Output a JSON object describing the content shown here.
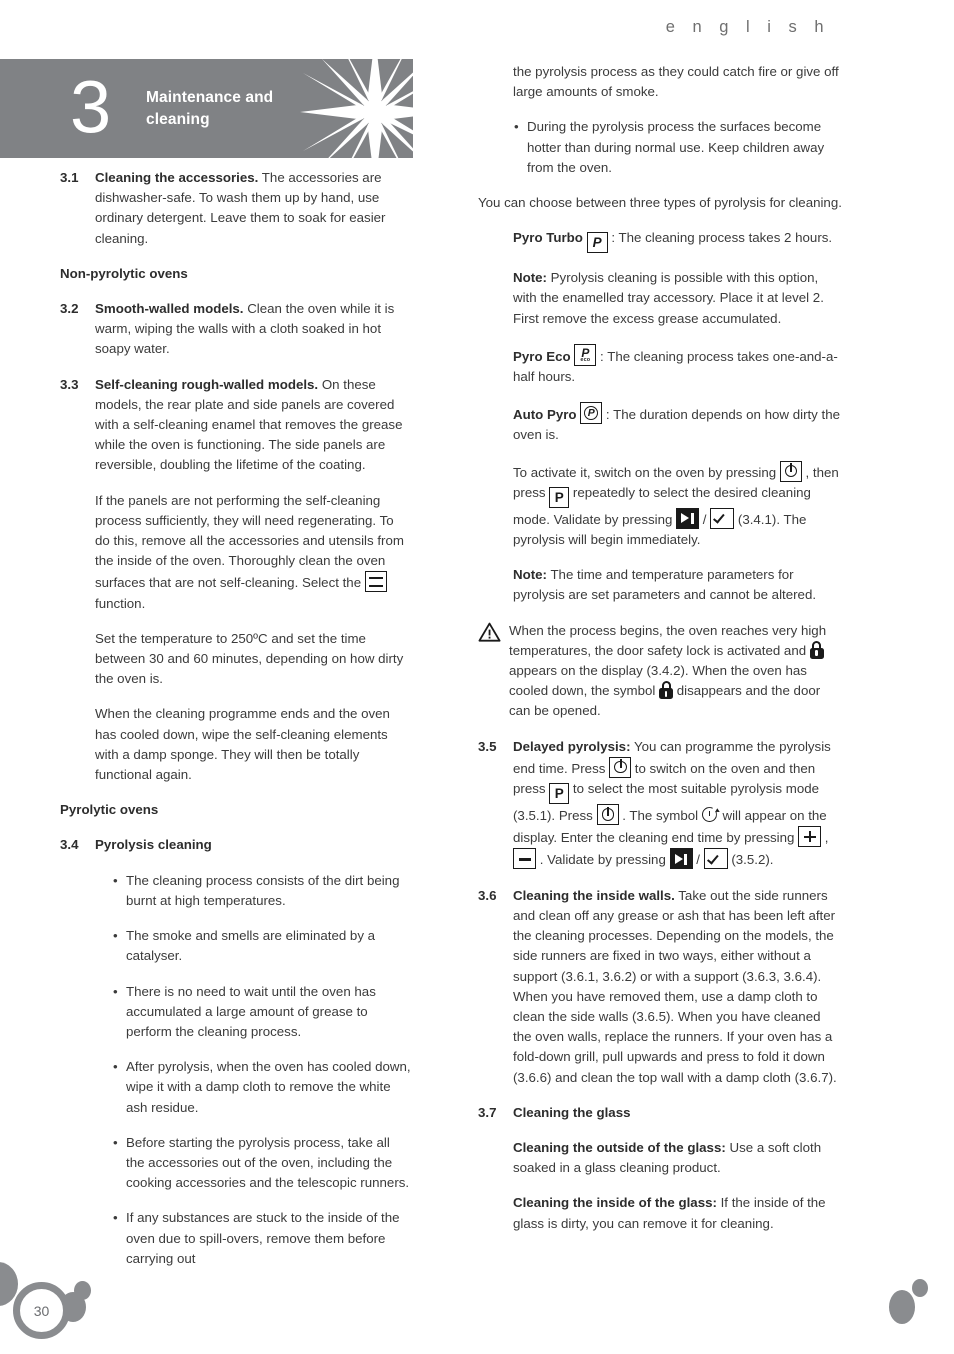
{
  "page": {
    "language_label": "e n g l i s h",
    "page_number": "30",
    "accent_gray": "#808285",
    "text_gray": "#3b3b3b",
    "heading_dark": "#2d2d2d"
  },
  "chapter": {
    "number": "3",
    "title_line1": "Maintenance and",
    "title_line2": "cleaning",
    "decor_icon": "starburst-icon"
  },
  "left_column": {
    "s31": {
      "num": "3.1",
      "title": "Cleaning the accessories.",
      "body": " The accessories are dishwasher-safe. To wash them up by hand, use ordinary detergent. Leave them to soak for easier cleaning."
    },
    "heading_non_pyrolytic": "Non-pyrolytic ovens",
    "s32": {
      "num": "3.2",
      "title": "Smooth-walled models.",
      "body": " Clean the oven while it is warm, wiping the walls with a cloth soaked in hot soapy water."
    },
    "s33": {
      "num": "3.3",
      "title": "Self-cleaning rough-walled models.",
      "body": " On these models, the rear plate and side panels are covered with a self-cleaning enamel that removes the grease while the oven is functioning. The side panels are reversible, doubling the lifetime of the coating.",
      "para2_a": "If the panels are not performing the self-cleaning process sufficiently, they will need regenerating. To do this, remove all the accessories and utensils from the inside of the oven. Thoroughly clean the oven surfaces that are not self-cleaning. Select the ",
      "para2_icon": "heating-element-icon",
      "para2_b": " function.",
      "para3": "Set the temperature to 250ºC and set the time between 30 and 60 minutes, depending on how dirty the oven is.",
      "para4": "When the cleaning programme ends and the oven has cooled down, wipe the self-cleaning elements with a damp sponge. They will then be totally functional again."
    },
    "heading_pyrolytic": "Pyrolytic ovens",
    "s34": {
      "num": "3.4",
      "title": "Pyrolysis cleaning",
      "bullets": [
        "The cleaning process consists of the dirt being burnt at high temperatures.",
        "The smoke and smells are eliminated by a catalyser.",
        "There is no need to wait until the oven has accumulated a large amount of grease to perform the cleaning process.",
        "After pyrolysis, when the oven has cooled down, wipe it with a damp cloth to remove the white ash residue.",
        "Before starting the pyrolysis process, take all the accessories out of the oven, including the cooking accessories and the telescopic runners.",
        "If any substances are stuck to the inside of the oven due to spill-overs, remove them before carrying out"
      ],
      "bullet_marker": "•"
    }
  },
  "right_column": {
    "continuation": "the pyrolysis process as they could catch fire or give off large amounts of smoke.",
    "bullet_children": "During the pyrolysis process the surfaces become hotter than during normal use. Keep children away from the oven.",
    "bullet_marker": "•",
    "choose_line": "You can choose between three types of pyrolysis for cleaning.",
    "pyro_turbo": {
      "label": "Pyro Turbo",
      "icon": "pyro-p-key-icon",
      "body": " : The cleaning process takes 2 hours."
    },
    "note_turbo": {
      "label": "Note:",
      "body": " Pyrolysis cleaning is possible with this option, with the enamelled tray accessory. Place it at level 2. First remove the excess grease accumulated."
    },
    "pyro_eco": {
      "label": "Pyro Eco",
      "icon": "pyro-eco-key-icon",
      "icon_p": "P",
      "icon_sub": "eco",
      "body": " : The cleaning process takes one-and-a-half hours."
    },
    "auto_pyro": {
      "label": "Auto Pyro",
      "icon": "auto-pyro-circled-p-key-icon",
      "icon_p": "P",
      "body": " : The duration depends on how dirty the oven is."
    },
    "activate": {
      "a": "To activate it, switch on the oven by pressing ",
      "icon_power": "power-key-icon",
      "b": " , then press ",
      "icon_p": "p-key-icon",
      "icon_p_label": "P",
      "c": " repeatedly to select the desired cleaning mode. Validate by pressing ",
      "icon_play": "play-pause-key-icon",
      "d": " / ",
      "icon_check": "check-key-icon",
      "e": " (3.4.1). The pyrolysis will begin immediately."
    },
    "note_params": {
      "label": "Note:",
      "body": " The time and temperature parameters for pyrolysis are set parameters and cannot be altered."
    },
    "warning": {
      "icon": "warning-triangle-icon",
      "a": "When the process begins, the oven reaches very high temperatures, the door safety lock is activated and ",
      "icon_lock1": "padlock-icon",
      "b": " appears on the display (3.4.2). When the oven has cooled down, the symbol ",
      "icon_lock2": "padlock-icon",
      "c": " disappears and the door can be opened."
    },
    "s35": {
      "num": "3.5",
      "title": "Delayed pyrolysis:",
      "a": " You can programme the pyrolysis end time. Press ",
      "icon_power1": "power-key-icon",
      "b": " to switch on the oven and then press ",
      "icon_p": "p-key-icon",
      "icon_p_label": "P",
      "c": " to select the most suitable pyrolysis mode (3.5.1). Press ",
      "icon_power2": "power-key-icon",
      "d": " . The symbol ",
      "icon_timer": "delayed-start-timer-icon",
      "e": " will appear on the display. Enter the cleaning end time by pressing ",
      "icon_plus": "plus-key-icon",
      "f": " , ",
      "icon_minus": "minus-key-icon",
      "g": " . Validate by pressing ",
      "icon_play": "play-pause-key-icon",
      "h": " / ",
      "icon_check": "check-key-icon",
      "i": " (3.5.2)."
    },
    "s36": {
      "num": "3.6",
      "title": "Cleaning the inside walls.",
      "body": " Take out the side runners and clean off any grease or ash that has been left after the cleaning processes. Depending on the models, the side runners are fixed in two ways, either without a support (3.6.1, 3.6.2) or with a support (3.6.3, 3.6.4). When you have removed them, use a damp cloth to clean the side walls (3.6.5). When you have cleaned the oven walls, replace the runners. If your oven has a fold-down grill, pull upwards and press to fold it down (3.6.6) and clean the top wall with a damp cloth (3.6.7)."
    },
    "s37": {
      "num": "3.7",
      "title": "Cleaning the glass",
      "outside_label": "Cleaning the outside of the glass:",
      "outside_body": " Use a soft cloth soaked in a glass cleaning product.",
      "inside_label": "Cleaning the inside of the glass:",
      "inside_body": " If the inside of the glass is dirty, you can remove it for cleaning."
    }
  }
}
